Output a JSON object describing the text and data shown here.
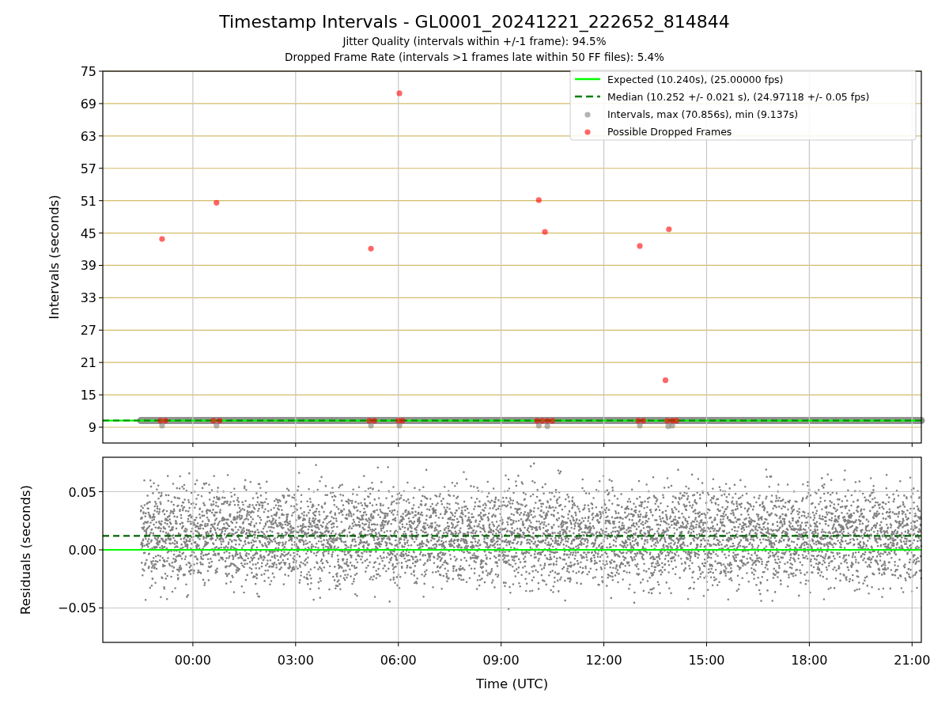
{
  "figure": {
    "title": "Timestamp Intervals - GL0001_20241221_222652_814844",
    "subtitles": [
      "Jitter Quality (intervals within +/-1 frame): 94.5%",
      "Dropped Frame Rate (intervals >1 frames late within 50 FF files): 5.4%"
    ]
  },
  "intervals_plot": {
    "chart_data": {
      "type": "scatter",
      "ylabel": "Intervals (seconds)",
      "xlim": [
        -2.63,
        21.27
      ],
      "ylim": [
        6.07,
        75
      ],
      "grid": true,
      "yticks": [
        {
          "value": 9,
          "label": "9"
        },
        {
          "value": 15,
          "label": "15"
        },
        {
          "value": 21,
          "label": "21"
        },
        {
          "value": 27,
          "label": "27"
        },
        {
          "value": 33,
          "label": "33"
        },
        {
          "value": 39,
          "label": "39"
        },
        {
          "value": 45,
          "label": "45"
        },
        {
          "value": 51,
          "label": "51"
        },
        {
          "value": 57,
          "label": "57"
        },
        {
          "value": 63,
          "label": "63"
        },
        {
          "value": 69,
          "label": "69"
        },
        {
          "value": 75,
          "label": "75"
        }
      ],
      "ref_lines": [
        {
          "axis": "y",
          "value": 10.24,
          "label": "Expected (10.240s), (25.00000 fps)",
          "color": "#00ff00"
        },
        {
          "axis": "y",
          "value": 10.252,
          "label": "Median (10.252 +/- 0.021 s), (24.97118 +/- 0.05 fps)",
          "color": "#008000"
        }
      ],
      "legend": true,
      "series": [
        {
          "name": "Intervals, max (70.856s), min (9.137s)",
          "color": "#808080",
          "x": [
            -0.9,
            0.69,
            5.2,
            6.03,
            10.1,
            10.35,
            13.05,
            13.88,
            14.0
          ],
          "values": [
            9.3,
            9.3,
            9.3,
            9.3,
            9.3,
            9.2,
            9.3,
            9.2,
            9.3
          ]
        },
        {
          "name": "Possible Dropped Frames",
          "color": "#ff0000",
          "x": [
            -0.9,
            0.69,
            5.2,
            6.03,
            10.1,
            10.28,
            13.05,
            13.9,
            13.8,
            -0.95,
            -0.8,
            0.6,
            0.78,
            5.15,
            5.3,
            6.0,
            6.12,
            10.05,
            10.2,
            10.35,
            10.5,
            13.0,
            13.15,
            13.85,
            14.0,
            14.12
          ],
          "values": [
            43.9,
            50.6,
            42.1,
            70.9,
            51.1,
            45.2,
            42.6,
            45.7,
            17.7,
            10.2,
            10.2,
            10.2,
            10.2,
            10.2,
            10.2,
            10.2,
            10.2,
            10.2,
            10.2,
            10.2,
            10.2,
            10.2,
            10.2,
            10.2,
            10.2,
            10.2
          ]
        }
      ]
    }
  },
  "residuals_plot": {
    "chart_data": {
      "type": "scatter",
      "xlabel": "Time (UTC)",
      "ylabel": "Residuals (seconds)",
      "xlim": [
        -2.63,
        21.27
      ],
      "ylim": [
        -0.0796,
        0.0796
      ],
      "grid": true,
      "xticks": [
        {
          "value": 0,
          "label": "00:00"
        },
        {
          "value": 3,
          "label": "03:00"
        },
        {
          "value": 6,
          "label": "06:00"
        },
        {
          "value": 9,
          "label": "09:00"
        },
        {
          "value": 12,
          "label": "12:00"
        },
        {
          "value": 15,
          "label": "15:00"
        },
        {
          "value": 18,
          "label": "18:00"
        },
        {
          "value": 21,
          "label": "21:00"
        }
      ],
      "yticks": [
        {
          "value": 0.05,
          "label": "0.05"
        },
        {
          "value": 0,
          "label": "0.00"
        },
        {
          "value": -0.05,
          "label": "−0.05"
        }
      ],
      "ref_lines": [
        {
          "axis": "y",
          "value": 0,
          "color": "#00ff00"
        },
        {
          "axis": "y",
          "value": 0.012,
          "color": "#006400"
        }
      ]
    }
  }
}
